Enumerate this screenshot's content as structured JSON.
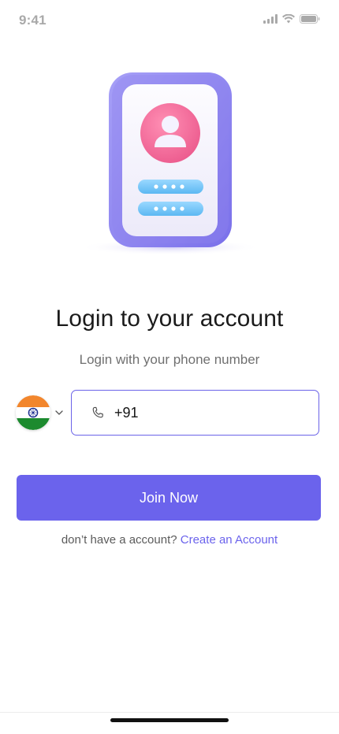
{
  "status_bar": {
    "time": "9:41",
    "icons": [
      "cellular-signal-icon",
      "wifi-icon",
      "battery-icon"
    ]
  },
  "illustration": {
    "name": "phone-login-illustration",
    "password_dots": [
      "••••",
      "••••"
    ]
  },
  "login": {
    "title": "Login to your account",
    "subtitle": "Login with your phone number"
  },
  "phone": {
    "country": "India",
    "flag_icon": "india-flag-icon",
    "value": "+91"
  },
  "actions": {
    "join_label": "Join Now",
    "signup_prompt": "don’t have a account?",
    "signup_link": "Create an Account"
  },
  "colors": {
    "accent": "#6b63ec",
    "status_gray": "#a9a9a9",
    "title": "#1b1b1b",
    "subtitle": "#707070"
  }
}
